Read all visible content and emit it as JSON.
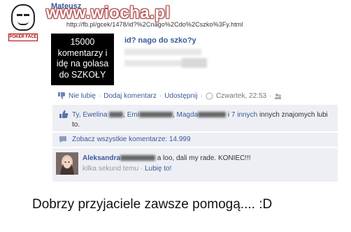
{
  "badge": {
    "caption": "POKER FACE"
  },
  "watermark": "www.wiocha.pl",
  "post": {
    "poster_name": "Mateusz",
    "link_url": "http://fb.pl/gcek/1478/id?%2Cnago%2Cdo%2Cszko%3Fy.html",
    "preview_image_text": [
      "15000",
      "komentarzy i",
      "idę na golasa",
      "do SZKOŁY"
    ],
    "preview_title": "id? nago do szko?y"
  },
  "actions": {
    "unlike": "Nie lubię",
    "comment": "Dodaj komentarz",
    "share": "Udostępnij",
    "time": "Czwartek, 22:53"
  },
  "likes": {
    "prefix": "Ty, Ewelina",
    "name2": "Emi",
    "name3": "Magda",
    "and": "i",
    "others": "7 innych",
    "suffix": "innych znajomych lubi to."
  },
  "comments": {
    "view_all": "Zobacz wszystkie komentarze: 14.999"
  },
  "comment": {
    "author": "Aleksandra",
    "text": "a loo, dali my rade. KONIEC!!!",
    "time": "kilka sekund temu",
    "like_link": "Lubię to!"
  },
  "bottom_caption": "Dobrzy przyjaciele zawsze pomogą.... :D",
  "colors": {
    "link": "#3b5998",
    "feedback_bg": "#edeff4",
    "watermark_outline": "#b04a4a"
  }
}
